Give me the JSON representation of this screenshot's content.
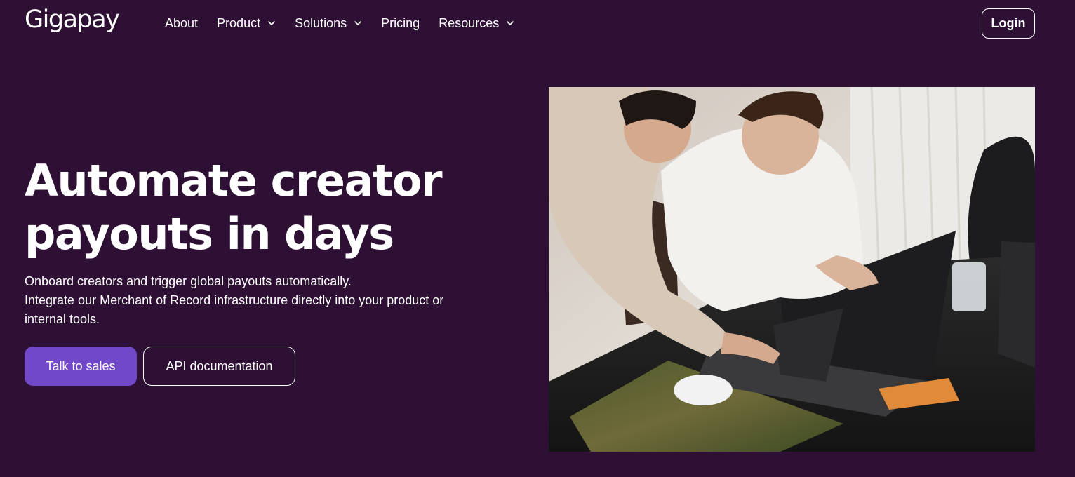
{
  "brand": {
    "logo_text": "Gigapay"
  },
  "nav": {
    "items": [
      {
        "label": "About",
        "has_dropdown": false
      },
      {
        "label": "Product",
        "has_dropdown": true
      },
      {
        "label": "Solutions",
        "has_dropdown": true
      },
      {
        "label": "Pricing",
        "has_dropdown": false
      },
      {
        "label": "Resources",
        "has_dropdown": true
      }
    ],
    "login_label": "Login"
  },
  "hero": {
    "title_line1": "Automate creator",
    "title_line2": "payouts in days",
    "subtitle_line1": "Onboard creators and trigger global payouts automatically.",
    "subtitle_line2": "Integrate our Merchant of Record infrastructure directly into your product or",
    "subtitle_line3": "internal tools.",
    "primary_cta": "Talk to sales",
    "secondary_cta": "API documentation"
  },
  "colors": {
    "background": "#2d1033",
    "accent": "#7048c8",
    "text": "#ffffff"
  }
}
